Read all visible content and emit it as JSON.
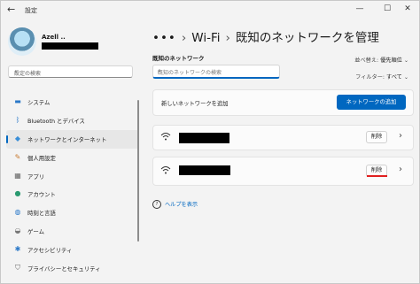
{
  "window": {
    "title": "設定",
    "back_icon": "back-arrow-icon",
    "controls": [
      "—",
      "☐",
      "✕"
    ]
  },
  "profile": {
    "name": "Azell .."
  },
  "search": {
    "placeholder": "設定の検索"
  },
  "sidebar": {
    "items": [
      {
        "label": "システム",
        "icon": "monitor-icon",
        "color": "#2a78c8"
      },
      {
        "label": "Bluetooth とデバイス",
        "icon": "bluetooth-icon",
        "color": "#2a78c8"
      },
      {
        "label": "ネットワークとインターネット",
        "icon": "network-icon",
        "color": "#3a8fd8",
        "active": true
      },
      {
        "label": "個人用設定",
        "icon": "brush-icon",
        "color": "#c77a30"
      },
      {
        "label": "アプリ",
        "icon": "apps-icon",
        "color": "#666666"
      },
      {
        "label": "アカウント",
        "icon": "account-icon",
        "color": "#2a9a70"
      },
      {
        "label": "時刻と言語",
        "icon": "globe-clock-icon",
        "color": "#2a78c8"
      },
      {
        "label": "ゲーム",
        "icon": "game-icon",
        "color": "#777777"
      },
      {
        "label": "アクセシビリティ",
        "icon": "accessibility-icon",
        "color": "#2a78c8"
      },
      {
        "label": "プライバシーとセキュリティ",
        "icon": "shield-icon",
        "color": "#666666"
      }
    ]
  },
  "breadcrumb": {
    "dots": "•••",
    "sep": "›",
    "parent": "Wi-Fi",
    "current": "既知のネットワークを管理"
  },
  "known_networks": {
    "title": "既知のネットワーク",
    "search_placeholder": "既知のネットワークの検索",
    "sort_label": "並べ替え:",
    "sort_value": "優先順位",
    "filter_label": "フィルター:",
    "filter_value": "すべて",
    "add_label": "新しいネットワークを追加",
    "add_button": "ネットワークの追加",
    "networks": [
      {
        "delete_label": "削除"
      },
      {
        "delete_label": "削除"
      }
    ]
  },
  "help": {
    "label": "ヘルプを表示"
  },
  "colors": {
    "accent": "#0067c0",
    "highlight": "#e02020"
  }
}
